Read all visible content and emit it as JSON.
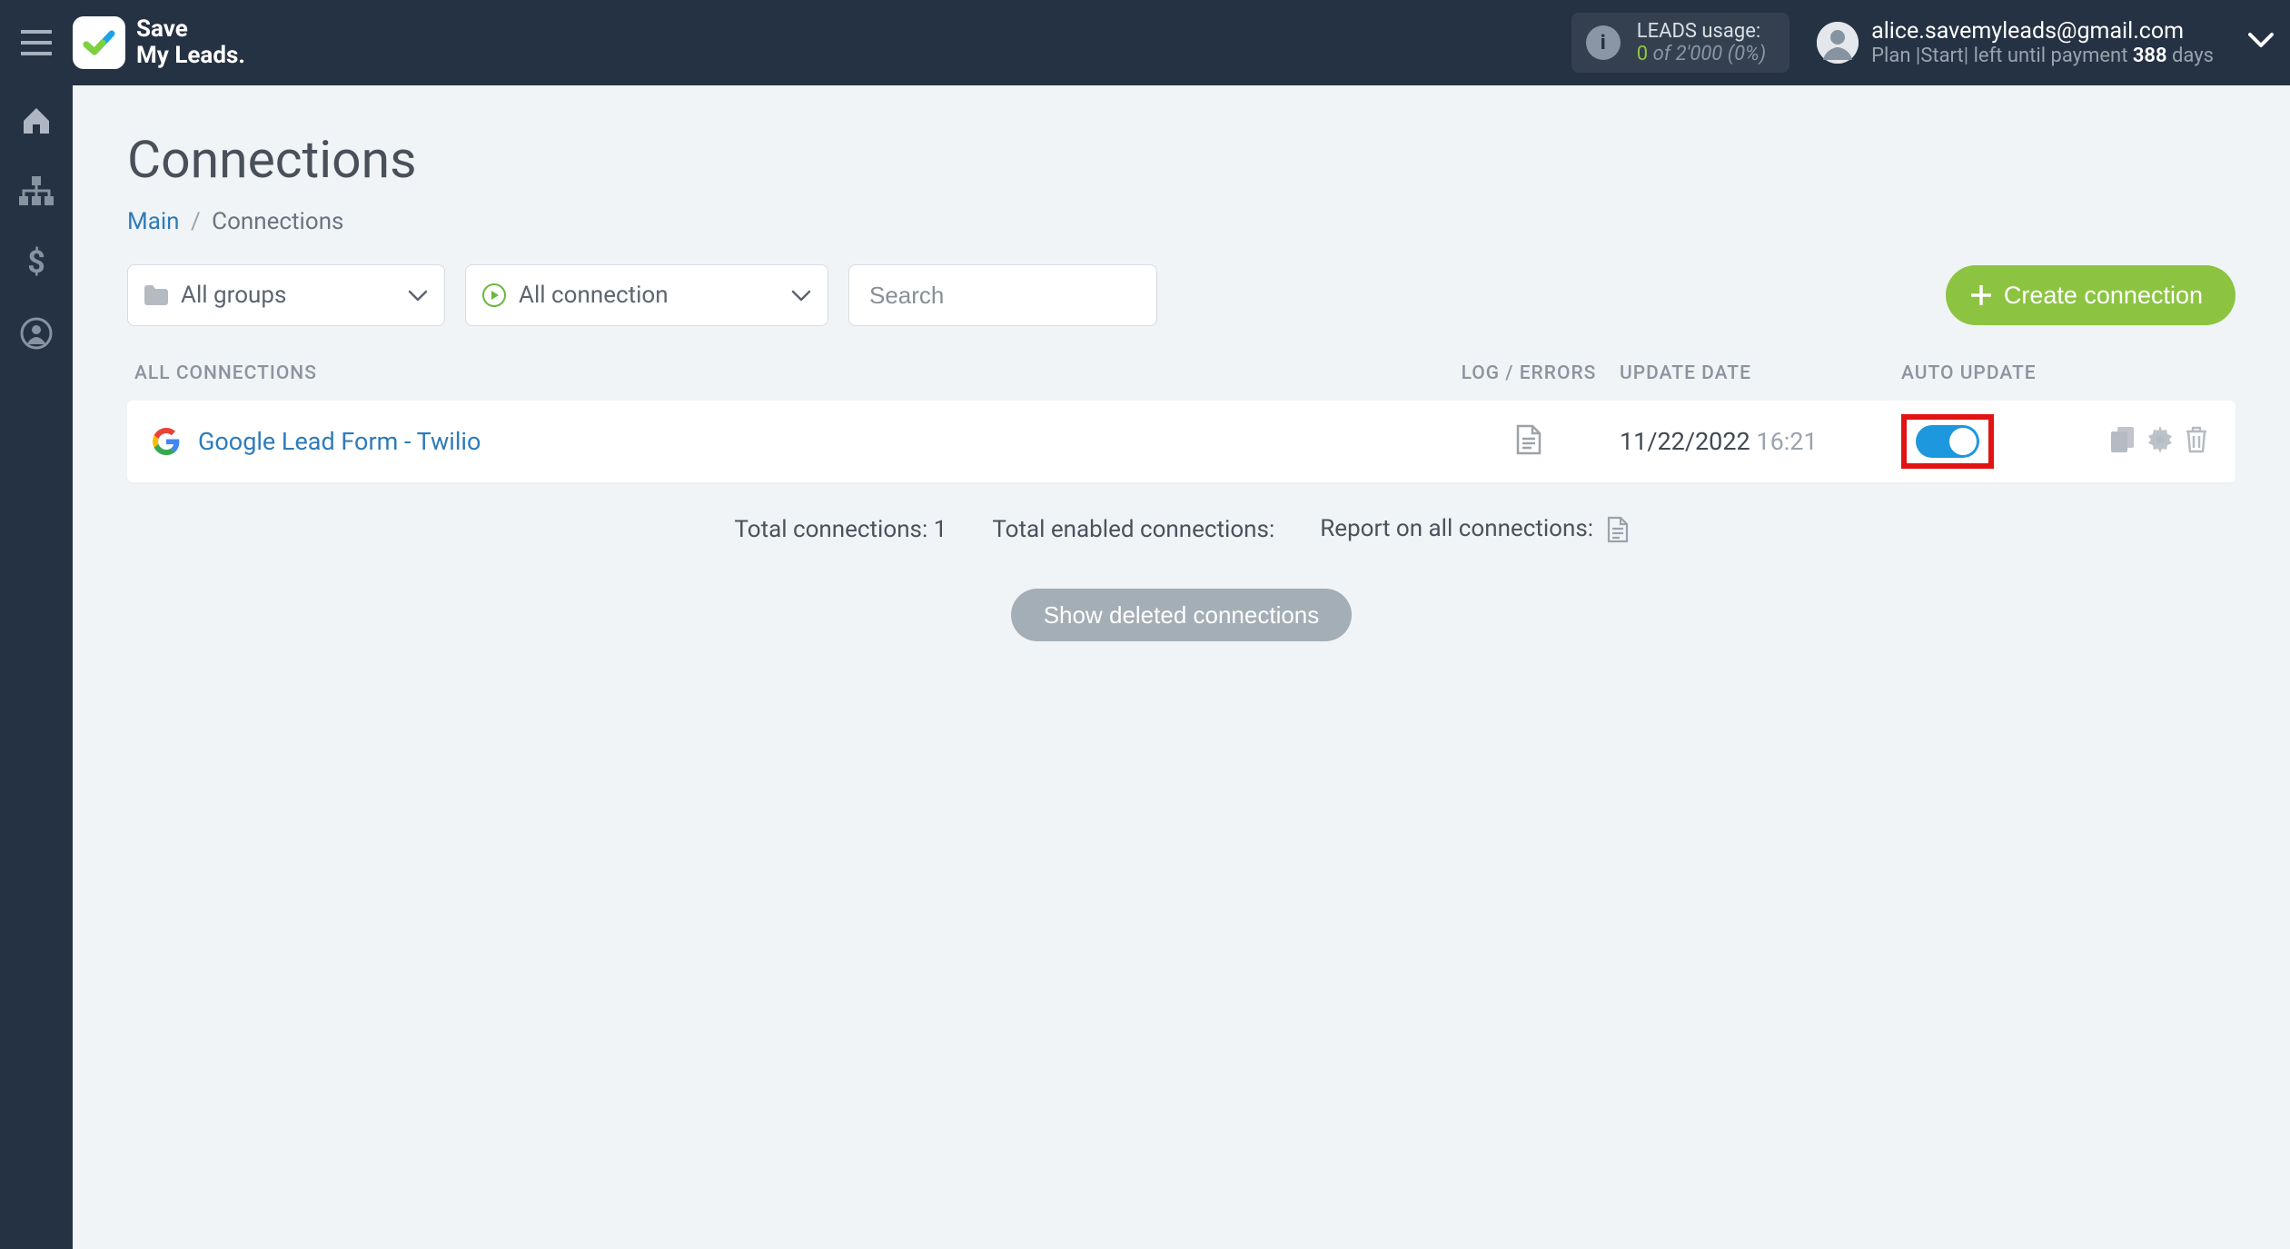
{
  "brand": {
    "line1": "Save",
    "line2": "My Leads."
  },
  "leads_usage": {
    "label": "LEADS usage:",
    "used": "0",
    "of_word": "of",
    "max": "2'000",
    "percent": "(0%)"
  },
  "user": {
    "email": "alice.savemyleads@gmail.com",
    "plan_prefix": "Plan |",
    "plan_name": "Start",
    "plan_mid": "| left until payment ",
    "days_num": "388",
    "days_word": " days"
  },
  "page": {
    "title": "Connections",
    "breadcrumb_main": "Main",
    "breadcrumb_current": "Connections"
  },
  "filters": {
    "groups_label": "All groups",
    "connection_label": "All connection",
    "search_placeholder": "Search"
  },
  "create_button": "Create connection",
  "table": {
    "headers": {
      "all": "ALL CONNECTIONS",
      "log": "LOG / ERRORS",
      "update": "UPDATE DATE",
      "auto": "AUTO UPDATE"
    },
    "row": {
      "name": "Google Lead Form - Twilio",
      "date": "11/22/2022",
      "time": "16:21"
    }
  },
  "footer": {
    "total_label": "Total connections: ",
    "total_value": "1",
    "enabled_label": "Total enabled connections:",
    "report_label": "Report on all connections:"
  },
  "deleted_button": "Show deleted connections"
}
